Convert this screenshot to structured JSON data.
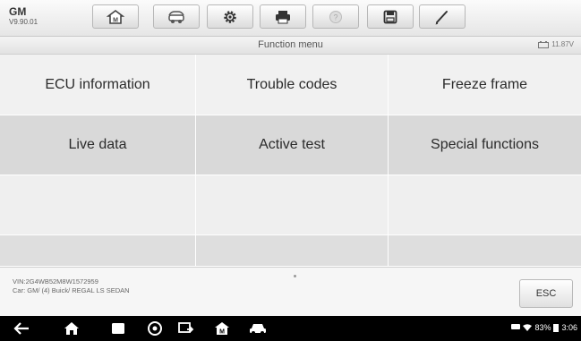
{
  "app": {
    "brand": "GM",
    "version": "V9.90.01"
  },
  "toolbar": {
    "items": [
      {
        "icon": "home-icon"
      },
      {
        "icon": "vehicle-swap-icon"
      },
      {
        "icon": "gear-icon"
      },
      {
        "icon": "printer-icon"
      },
      {
        "icon": "help-icon"
      },
      {
        "icon": "save-icon"
      },
      {
        "icon": "pen-icon"
      }
    ]
  },
  "header": {
    "title": "Function menu",
    "voltage": "11.87V"
  },
  "menu": {
    "items": [
      {
        "label": "ECU information"
      },
      {
        "label": "Trouble codes"
      },
      {
        "label": "Freeze frame"
      },
      {
        "label": "Live data"
      },
      {
        "label": "Active test"
      },
      {
        "label": "Special functions"
      }
    ]
  },
  "footer": {
    "vin": "VIN:2G4WB52M8W1572959",
    "car": "Car: GM/ (4) Buick/ REGAL LS SEDAN",
    "esc_label": "ESC"
  },
  "system": {
    "battery": "83%",
    "time": "3:06"
  }
}
